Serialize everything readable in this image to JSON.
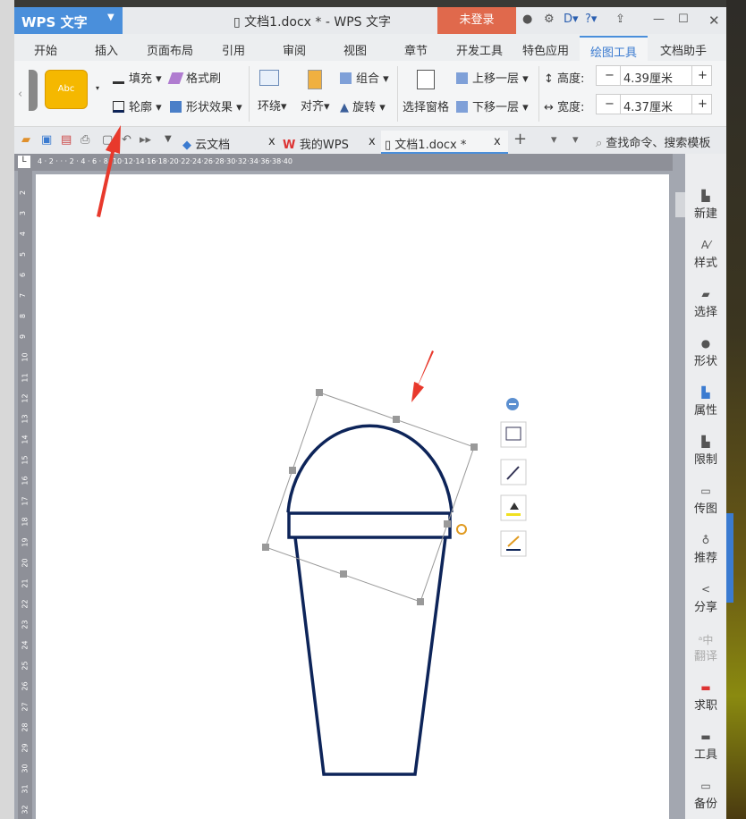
{
  "window": {
    "app_name": "WPS 文字",
    "title": "文档1.docx * - WPS 文字",
    "login": "未登录"
  },
  "menu_tabs": [
    "开始",
    "插入",
    "页面布局",
    "引用",
    "审阅",
    "视图",
    "章节",
    "开发工具",
    "特色应用",
    "绘图工具",
    "文档助手"
  ],
  "active_tab": "绘图工具",
  "ribbon": {
    "style_preview": "Abc",
    "fill": "填充",
    "format_painter": "格式刷",
    "outline": "轮廓",
    "shape_effects": "形状效果",
    "wrap": "环绕",
    "align": "对齐",
    "group": "组合",
    "rotate": "旋转",
    "selection_pane": "选择窗格",
    "bring_forward": "上移一层",
    "send_backward": "下移一层",
    "height_label": "高度:",
    "height_value": "4.39厘米",
    "width_label": "宽度:",
    "width_value": "4.37厘米",
    "minus": "−",
    "plus": "+"
  },
  "doc_tabs": [
    {
      "label": "云文档"
    },
    {
      "label": "我的WPS"
    },
    {
      "label": "文档1.docx *"
    }
  ],
  "search": "查找命令、搜索模板",
  "ruler_ticks": "4 · 2 ·  ·  · 2 · 4 · 6 · 8 ·10·12·14·16·18·20·22·24·26·28·30·32·34·36·38·40",
  "vruler_ticks": [
    "2",
    "3",
    "4",
    "5",
    "6",
    "7",
    "8",
    "9",
    "10",
    "11",
    "12",
    "13",
    "14",
    "15",
    "16",
    "17",
    "18",
    "19",
    "20",
    "21",
    "22",
    "23",
    "24",
    "25",
    "26",
    "27",
    "28",
    "29",
    "30",
    "31",
    "32"
  ],
  "sidebar": [
    {
      "label": "新建",
      "icon": "new-doc"
    },
    {
      "label": "样式",
      "icon": "style"
    },
    {
      "label": "选择",
      "icon": "select"
    },
    {
      "label": "形状",
      "icon": "shape"
    },
    {
      "label": "属性",
      "icon": "property"
    },
    {
      "label": "限制",
      "icon": "restrict"
    },
    {
      "label": "传图",
      "icon": "upload-image"
    },
    {
      "label": "推荐",
      "icon": "recommend"
    },
    {
      "label": "分享",
      "icon": "share"
    },
    {
      "label": "翻译",
      "icon": "translate"
    },
    {
      "label": "求职",
      "icon": "job"
    },
    {
      "label": "工具",
      "icon": "toolbox"
    },
    {
      "label": "备份",
      "icon": "backup"
    }
  ],
  "colors": {
    "accent": "#4a8fdb",
    "login": "#e0694c",
    "shape_stroke": "#0d2459",
    "style_fill": "#f5b800",
    "arrow": "#e8392c"
  }
}
